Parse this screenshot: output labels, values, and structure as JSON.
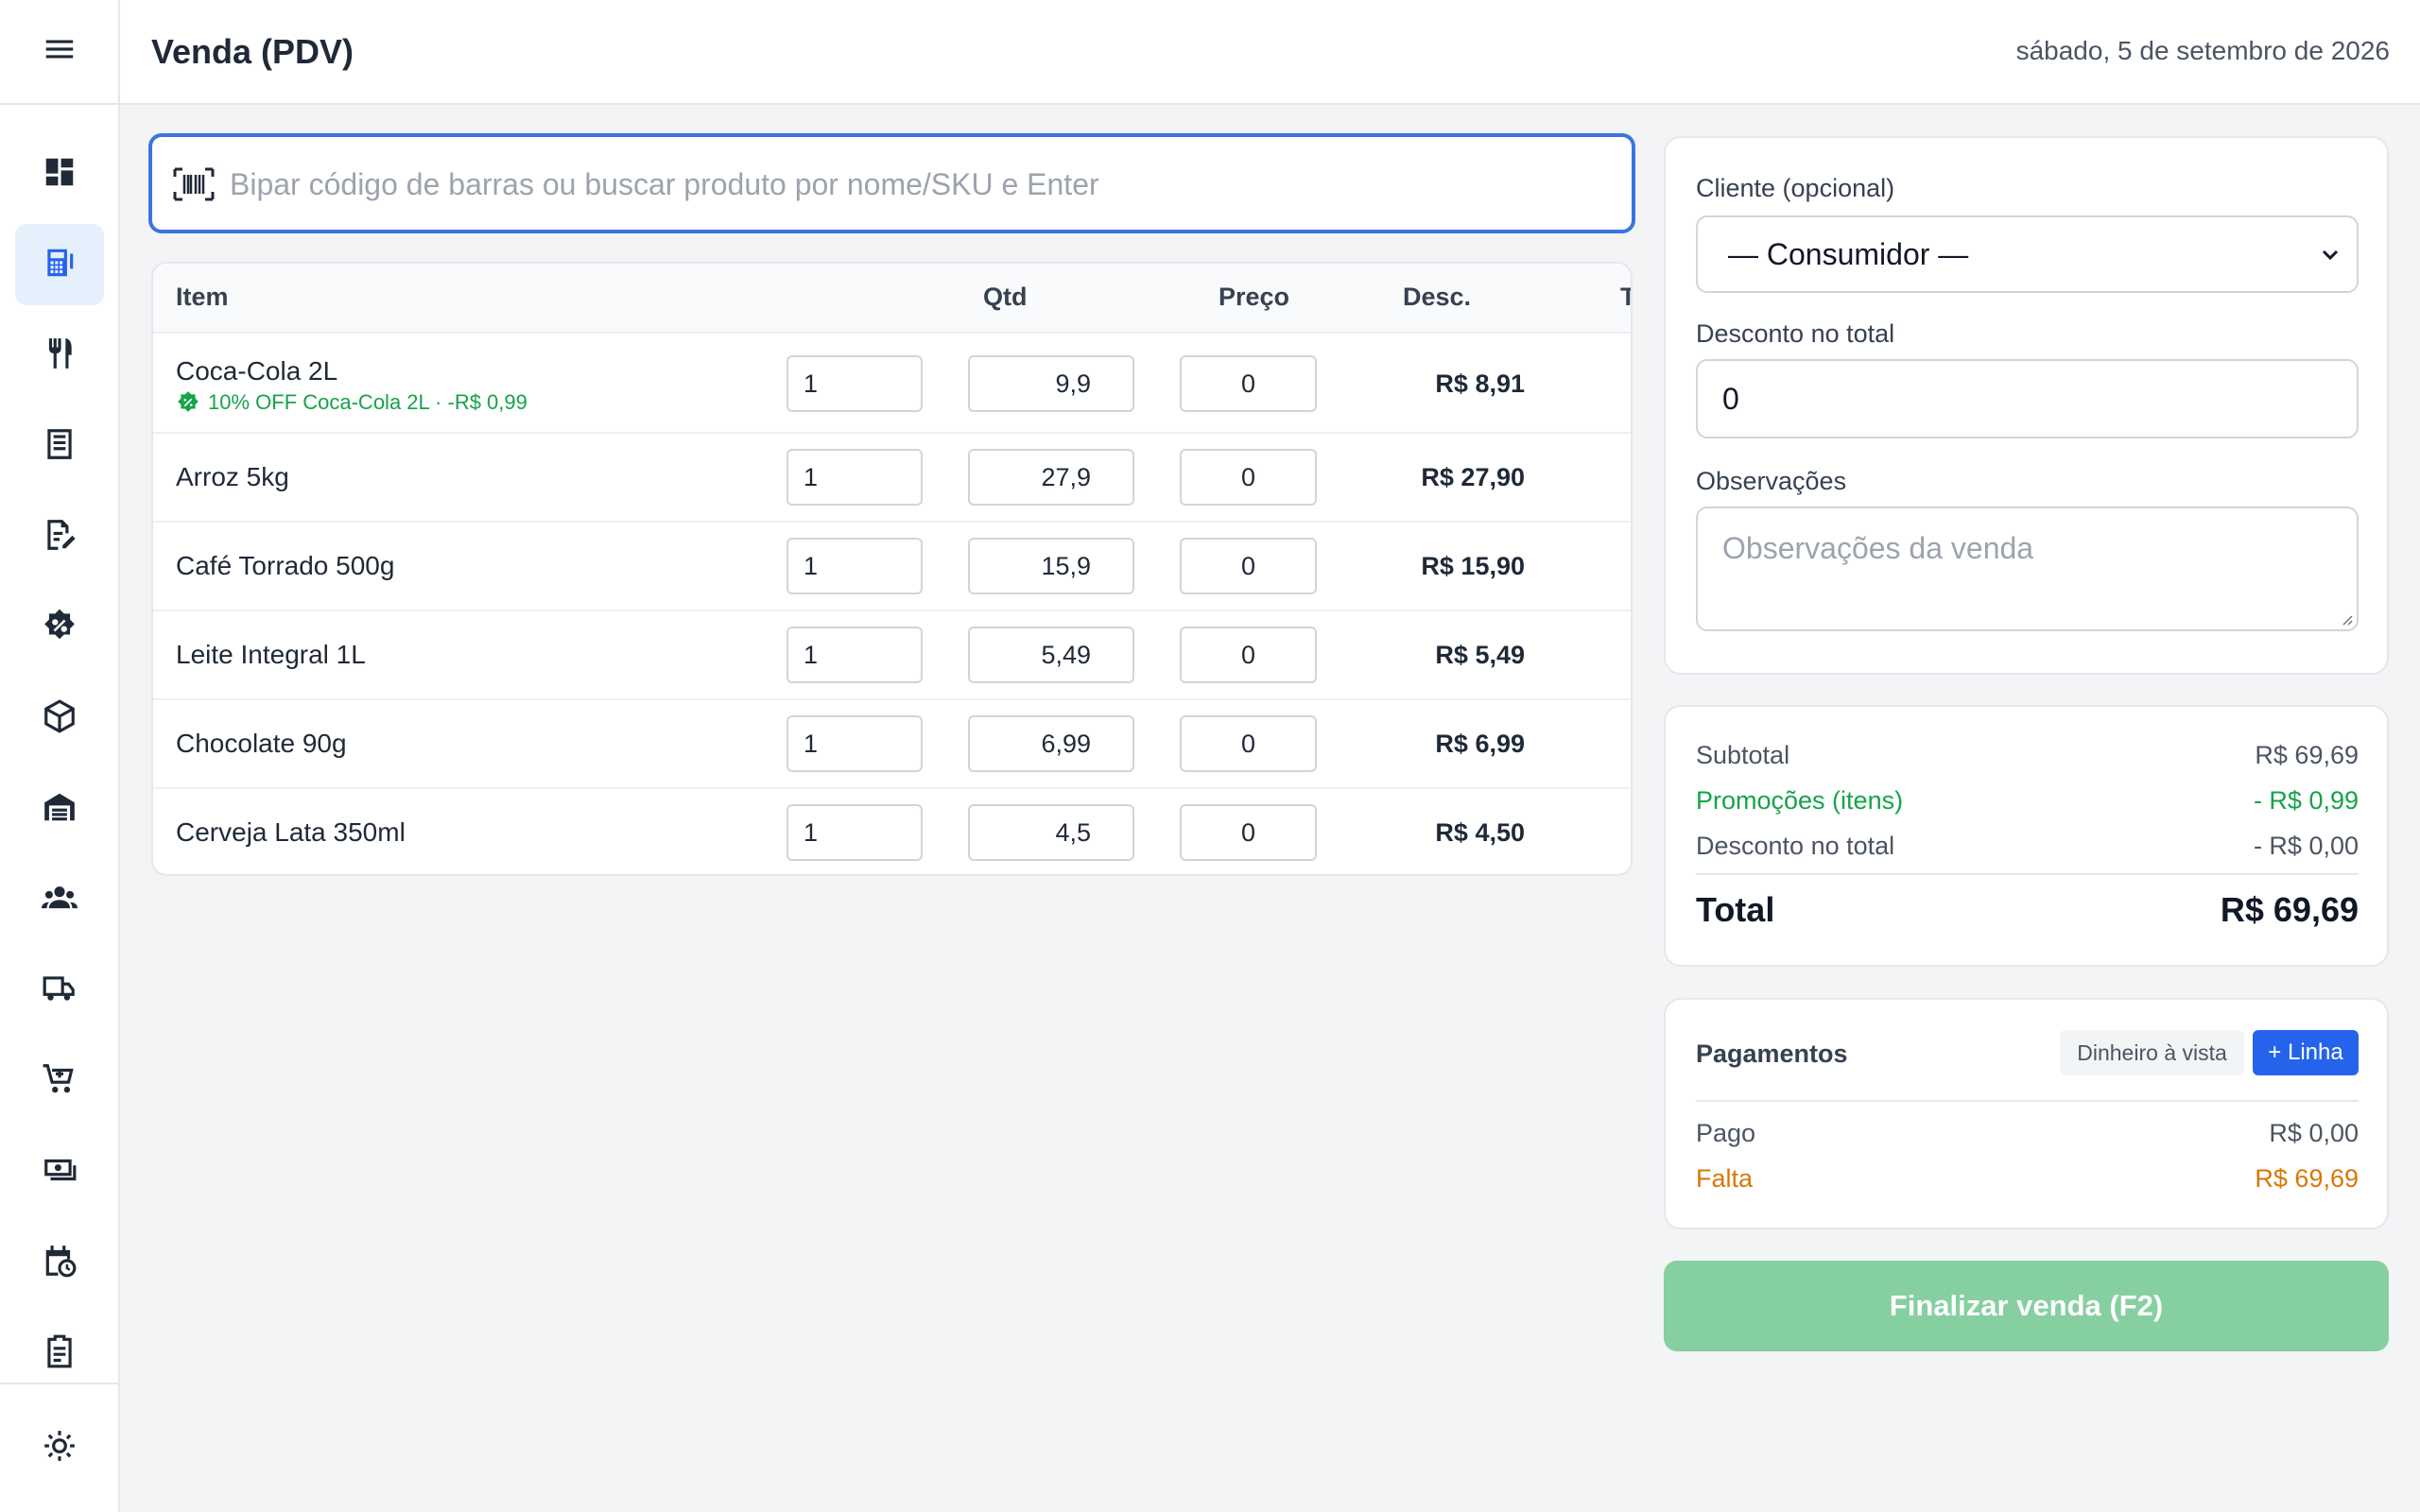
{
  "header": {
    "title": "Venda (PDV)",
    "date": "sábado, 5 de setembro de 2026"
  },
  "sidebar": {
    "items": [
      {
        "icon": "dashboard-icon"
      },
      {
        "icon": "pos-register-icon",
        "active": true
      },
      {
        "icon": "restaurant-icon"
      },
      {
        "icon": "receipt-list-icon"
      },
      {
        "icon": "edit-document-icon"
      },
      {
        "icon": "discount-badge-icon"
      },
      {
        "icon": "box-icon"
      },
      {
        "icon": "warehouse-icon"
      },
      {
        "icon": "customers-icon"
      },
      {
        "icon": "truck-icon"
      },
      {
        "icon": "cart-add-icon"
      },
      {
        "icon": "money-icon"
      },
      {
        "icon": "calendar-clock-icon"
      },
      {
        "icon": "clipboard-icon"
      }
    ],
    "bottom_icon": "theme-toggle-icon"
  },
  "search": {
    "placeholder": "Bipar código de barras ou buscar produto por nome/SKU e Enter",
    "value": ""
  },
  "table": {
    "headers": {
      "item": "Item",
      "qty": "Qtd",
      "price": "Preço",
      "discount": "Desc.",
      "total": "Total"
    },
    "rows": [
      {
        "name": "Coca-Cola 2L",
        "promo": "10% OFF Coca-Cola 2L · -R$ 0,99",
        "qty": "1",
        "price": "9,9",
        "discount": "0",
        "total": "R$ 8,91"
      },
      {
        "name": "Arroz 5kg",
        "qty": "1",
        "price": "27,9",
        "discount": "0",
        "total": "R$ 27,90"
      },
      {
        "name": "Café Torrado 500g",
        "qty": "1",
        "price": "15,9",
        "discount": "0",
        "total": "R$ 15,90"
      },
      {
        "name": "Leite Integral 1L",
        "qty": "1",
        "price": "5,49",
        "discount": "0",
        "total": "R$ 5,49"
      },
      {
        "name": "Chocolate 90g",
        "qty": "1",
        "price": "6,99",
        "discount": "0",
        "total": "R$ 6,99"
      },
      {
        "name": "Cerveja Lata 350ml",
        "qty": "1",
        "price": "4,5",
        "discount": "0",
        "total": "R$ 4,50"
      }
    ]
  },
  "customer": {
    "client_label": "Cliente (opcional)",
    "client_value": "— Consumidor —",
    "discount_label": "Desconto no total",
    "discount_value": "0",
    "notes_label": "Observações",
    "notes_placeholder": "Observações da venda"
  },
  "summary": {
    "subtotal_label": "Subtotal",
    "subtotal": "R$ 69,69",
    "promos_label": "Promoções (itens)",
    "promos": "- R$ 0,99",
    "discount_label": "Desconto no total",
    "discount": "- R$ 0,00",
    "total_label": "Total",
    "total": "R$ 69,69"
  },
  "payments": {
    "title": "Pagamentos",
    "cash_button": "Dinheiro à vista",
    "add_button": "+ Linha",
    "paid_label": "Pago",
    "paid": "R$ 0,00",
    "missing_label": "Falta",
    "missing": "R$ 69,69"
  },
  "finish_button": "Finalizar venda (F2)",
  "colors": {
    "accent": "#2563eb",
    "success": "#16a34a",
    "warning": "#d97706",
    "finish_disabled": "#86cfa0"
  }
}
